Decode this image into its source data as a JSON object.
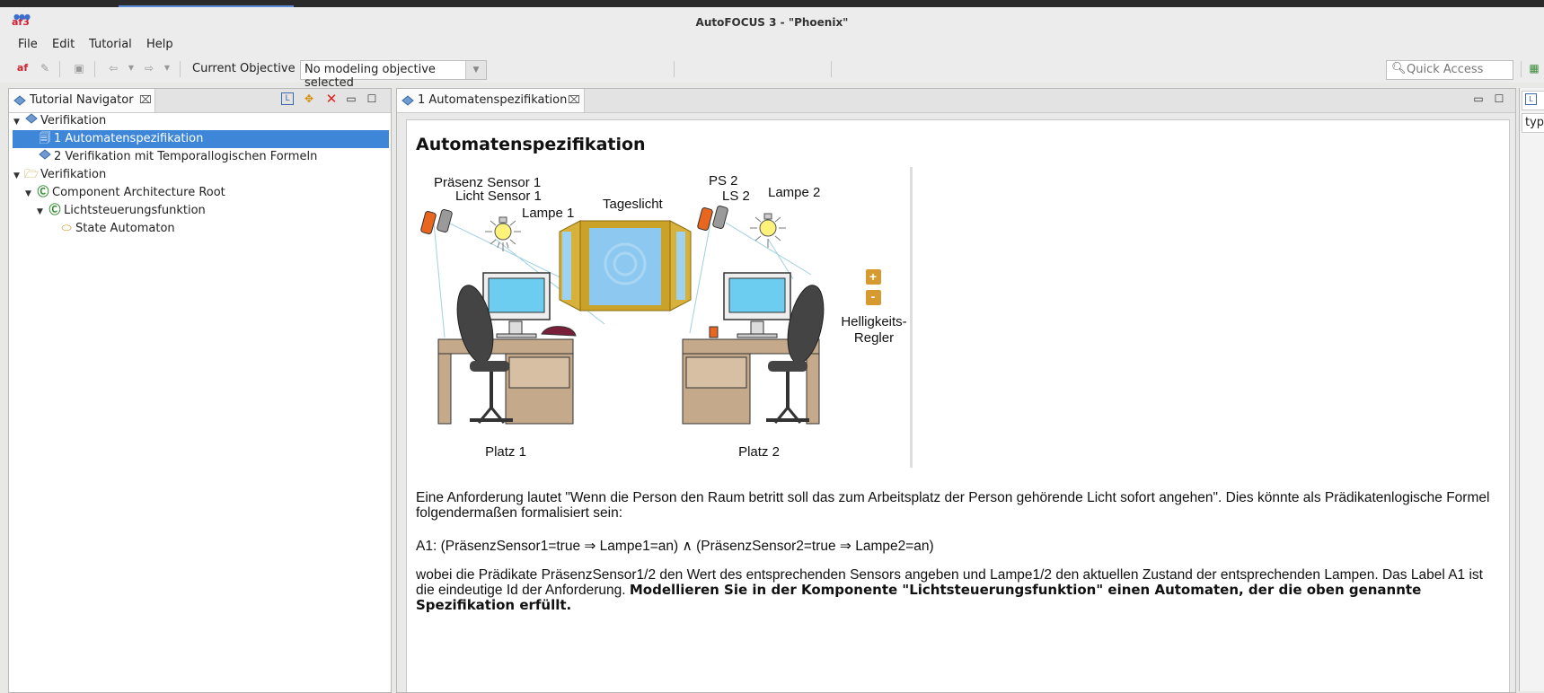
{
  "window": {
    "title": "AutoFOCUS 3 - \"Phoenix\"",
    "logo": "af3"
  },
  "menu": [
    "File",
    "Edit",
    "Tutorial",
    "Help"
  ],
  "toolbar": {
    "objective_label": "Current Objective",
    "objective_value": "No modeling objective selected",
    "quick_access_placeholder": "Quick Access"
  },
  "navigator": {
    "tab_title": "Tutorial Navigator",
    "tab_close": "⌧",
    "tree": [
      {
        "label": "Verifikation",
        "icon": "tutorial-icon",
        "level": 0,
        "expanded": true
      },
      {
        "label": "1 Automatenspezifikation",
        "icon": "page-icon",
        "level": 1,
        "selected": true
      },
      {
        "label": "2 Verifikation mit Temporallogischen Formeln",
        "icon": "tutorial-icon",
        "level": 1
      },
      {
        "label": "Verifikation",
        "icon": "folder-icon",
        "level": 0,
        "expanded": true
      },
      {
        "label": "Component Architecture Root",
        "icon": "component-icon",
        "level": 1,
        "expanded": true
      },
      {
        "label": "Lichtsteuerungsfunktion",
        "icon": "component-icon",
        "level": 2,
        "expanded": true
      },
      {
        "label": "State Automaton",
        "icon": "automaton-icon",
        "level": 3
      }
    ]
  },
  "editor": {
    "tab_title": "1 Automatenspezifikation",
    "tab_close": "⌧",
    "heading": "Automatenspezifikation",
    "figure_labels": {
      "praesenz1": "Präsenz Sensor 1",
      "licht1": "Licht Sensor 1",
      "lampe1": "Lampe 1",
      "tageslicht": "Tageslicht",
      "ps2": "PS 2",
      "ls2": "LS 2",
      "lampe2": "Lampe 2",
      "plus": "+",
      "minus": "-",
      "regler1": "Helligkeits-",
      "regler2": "Regler",
      "platz1": "Platz 1",
      "platz2": "Platz 2"
    },
    "para1": "Eine Anforderung lautet \"Wenn die Person den Raum betritt soll das zum Arbeitsplatz der Person gehörende Licht sofort angehen\". Dies könnte als Prädikatenlogische Formel folgendermaßen formalisiert sein:",
    "formula": "A1: (PräsenzSensor1=true ⇒ Lampe1=an) ∧ (PräsenzSensor2=true ⇒ Lampe2=an)",
    "para3_normal": "wobei die Prädikate PräsenzSensor1/2 den Wert des entsprechenden Sensors angeben und Lampe1/2 den aktuellen Zustand der entsprechenden Lampen. Das Label A1 ist die eindeutige Id der Anforderung. ",
    "para3_bold": "Modellieren Sie in der Komponente \"Lichtsteuerungsfunktion\" einen Automaten, der die oben genannte Spezifikation erfüllt."
  },
  "right_panel": {
    "input_value": "typ"
  }
}
